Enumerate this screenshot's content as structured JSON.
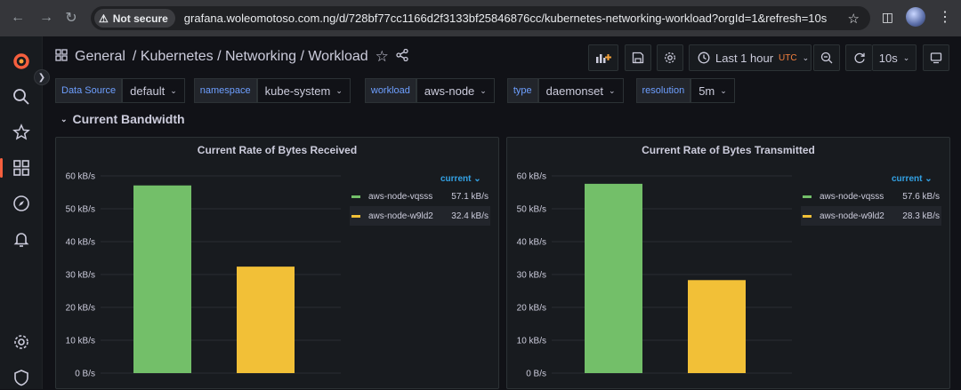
{
  "browser": {
    "security_label": "Not secure",
    "url": "grafana.woleomotoso.com.ng/d/728bf77cc1166d2f3133bf25846876cc/kubernetes-networking-workload?orgId=1&refresh=10s"
  },
  "dashboard": {
    "breadcrumb_root": "General",
    "breadcrumb_path": "/ Kubernetes / Networking / Workload"
  },
  "toolbar": {
    "time_range": "Last 1 hour",
    "timezone": "UTC",
    "refresh_interval": "10s"
  },
  "variables": [
    {
      "label": "Data Source",
      "value": "default"
    },
    {
      "label": "namespace",
      "value": "kube-system"
    },
    {
      "label": "workload",
      "value": "aws-node"
    },
    {
      "label": "type",
      "value": "daemonset"
    },
    {
      "label": "resolution",
      "value": "5m"
    }
  ],
  "row": {
    "title": "Current Bandwidth"
  },
  "colors": {
    "green": "#73bf69",
    "yellow": "#f2c037",
    "accent": "#f55f3e",
    "link": "#33a2e5"
  },
  "panels": [
    {
      "title": "Current Rate of Bytes Received",
      "legend_header": "current",
      "legend": [
        {
          "name": "aws-node-vqsss",
          "value": "57.1 kB/s"
        },
        {
          "name": "aws-node-w9ld2",
          "value": "32.4 kB/s"
        }
      ]
    },
    {
      "title": "Current Rate of Bytes Transmitted",
      "legend_header": "current",
      "legend": [
        {
          "name": "aws-node-vqsss",
          "value": "57.6 kB/s"
        },
        {
          "name": "aws-node-w9ld2",
          "value": "28.3 kB/s"
        }
      ]
    }
  ],
  "chart_data": [
    {
      "type": "bar",
      "title": "Current Rate of Bytes Received",
      "categories": [
        "aws-node-vqsss",
        "aws-node-w9ld2"
      ],
      "values": [
        57.1,
        32.4
      ],
      "unit": "kB/s",
      "ylim": [
        0,
        60
      ],
      "yticks": [
        "0 B/s",
        "10 kB/s",
        "20 kB/s",
        "30 kB/s",
        "40 kB/s",
        "50 kB/s",
        "60 kB/s"
      ],
      "grid": true,
      "legend": "right"
    },
    {
      "type": "bar",
      "title": "Current Rate of Bytes Transmitted",
      "categories": [
        "aws-node-vqsss",
        "aws-node-w9ld2"
      ],
      "values": [
        57.6,
        28.3
      ],
      "unit": "kB/s",
      "ylim": [
        0,
        60
      ],
      "yticks": [
        "0 B/s",
        "10 kB/s",
        "20 kB/s",
        "30 kB/s",
        "40 kB/s",
        "50 kB/s",
        "60 kB/s"
      ],
      "grid": true,
      "legend": "right"
    }
  ]
}
